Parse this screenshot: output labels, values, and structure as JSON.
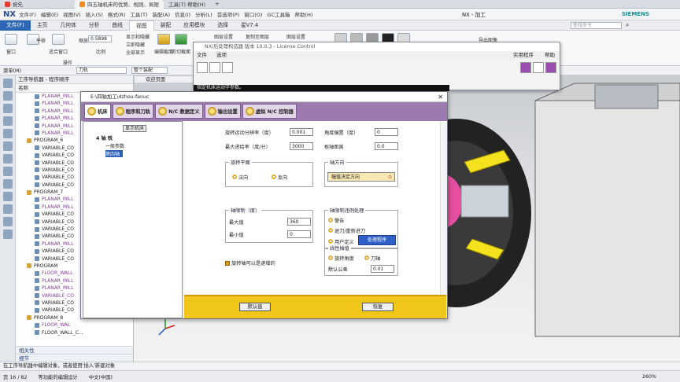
{
  "browser": {
    "tabs": [
      "祝先",
      "四五轴机床的优势、规则、局限",
      "工具(T) 帮助(H)"
    ],
    "new_tab": "+"
  },
  "titlebar": {
    "logo": "NX",
    "menus": [
      "文件(F)",
      "编辑(E)",
      "视图(V)",
      "插入(S)",
      "格式(R)",
      "工具(T)",
      "装配(A)",
      "信息(I)",
      "分析(L)",
      "首选项(P)",
      "窗口(O)",
      "GC工具箱",
      "帮助(H)"
    ],
    "title": "NX - 加工",
    "brand": "SIEMENS"
  },
  "ribbon": {
    "tabs": [
      "文件(F)",
      "主页",
      "几何体",
      "分析",
      "曲线",
      "视图",
      "装配",
      "应用模块",
      "选择",
      "星V7.4"
    ],
    "selected_tab": "视图",
    "search_placeholder": "查找命令",
    "tools_left": [
      "窗口",
      "平移",
      "适合窗口",
      "缩放",
      "0.5898",
      "比例"
    ],
    "group_op": "操作",
    "tools_mid": [
      "显示和隐藏",
      "立即隐藏",
      "全部显示",
      "编辑截面",
      "剪切截面"
    ],
    "tools_right": [
      "图层设置",
      "复制至图层",
      "图层设置",
      "导出图像"
    ]
  },
  "selbar": {
    "menu": "菜单(M)",
    "combo1": "刀轨",
    "combo2": "整个装配"
  },
  "navigator": {
    "title": "工序导航器 - 程序顺序",
    "column": "名称",
    "rows": [
      {
        "indent": 2,
        "text": "PLANAR_MILL",
        "style": "pur"
      },
      {
        "indent": 2,
        "text": "PLANAR_MILL",
        "style": "pur"
      },
      {
        "indent": 2,
        "text": "PLANAR_MILL",
        "style": "pur"
      },
      {
        "indent": 2,
        "text": "PLANAR_MILL",
        "style": "pur"
      },
      {
        "indent": 2,
        "text": "PLANAR_MILL",
        "style": "pur"
      },
      {
        "indent": 2,
        "text": "PLANAR_MILL",
        "style": "pur"
      },
      {
        "indent": 1,
        "text": "PROGRAM_6",
        "style": "bold"
      },
      {
        "indent": 2,
        "text": "VARIABLE_CO",
        "style": ""
      },
      {
        "indent": 2,
        "text": "VARIABLE_CO",
        "style": ""
      },
      {
        "indent": 2,
        "text": "VARIABLE_CO",
        "style": ""
      },
      {
        "indent": 2,
        "text": "VARIABLE_CO",
        "style": ""
      },
      {
        "indent": 2,
        "text": "VARIABLE_CO",
        "style": ""
      },
      {
        "indent": 2,
        "text": "VARIABLE_CO",
        "style": ""
      },
      {
        "indent": 1,
        "text": "PROGRAM_7",
        "style": "bold"
      },
      {
        "indent": 2,
        "text": "PLANAR_MILL",
        "style": "pur"
      },
      {
        "indent": 2,
        "text": "PLANAR_MILL",
        "style": "pur"
      },
      {
        "indent": 2,
        "text": "VARIABLE_CO",
        "style": ""
      },
      {
        "indent": 2,
        "text": "VARIABLE_CO",
        "style": ""
      },
      {
        "indent": 2,
        "text": "VARIABLE_CO",
        "style": ""
      },
      {
        "indent": 2,
        "text": "VARIABLE_CO",
        "style": ""
      },
      {
        "indent": 2,
        "text": "PLANAR_MILL",
        "style": "pur"
      },
      {
        "indent": 2,
        "text": "VARIABLE_CO",
        "style": ""
      },
      {
        "indent": 2,
        "text": "VARIABLE_CO",
        "style": ""
      },
      {
        "indent": 1,
        "text": "PROGRAM",
        "style": "bold"
      },
      {
        "indent": 2,
        "text": "FLOOR_WALL",
        "style": "pur"
      },
      {
        "indent": 2,
        "text": "PLANAR_MILL",
        "style": "pur"
      },
      {
        "indent": 2,
        "text": "PLANAR_MILL",
        "style": "pur"
      },
      {
        "indent": 2,
        "text": "VARIABLE_CO",
        "style": "pur"
      },
      {
        "indent": 2,
        "text": "VARIABLE_CO",
        "style": ""
      },
      {
        "indent": 2,
        "text": "VARIABLE_CO",
        "style": ""
      },
      {
        "indent": 1,
        "text": "PROGRAM_8",
        "style": "bold"
      },
      {
        "indent": 2,
        "text": "FLOOR_WAL",
        "style": "pur"
      },
      {
        "indent": 2,
        "text": "FLOOR_WALL_C...",
        "style": ""
      }
    ],
    "footer1": "相关性",
    "footer2": "细节"
  },
  "graphics": {
    "tab": "欢迎页面"
  },
  "license": {
    "title": "NX/后处理构造器 版本 10.0.3 - License Control",
    "menus": [
      "文件",
      "选项"
    ],
    "menus_right": [
      "实用程序",
      "帮助"
    ],
    "status": "指定机床运动学参数。"
  },
  "post": {
    "title": "E:\\四轴加工\\4zhou-fanuc",
    "tabs": [
      "机床",
      "程序和刀轨",
      "N/C 数据定义",
      "输出设置",
      "虚拟 N/C 控制器"
    ],
    "tree_header": "显示机床",
    "tree": [
      "4 轴 铣",
      "一般参数",
      "第四轴"
    ],
    "fields": {
      "rot_min_res_label": "旋转运动分辨率（度）",
      "rot_min_res": "0.001",
      "angle_offset_label": "角度偏置（度）",
      "angle_offset": "0",
      "max_feed_label": "最大进给率（度/分）",
      "max_feed": "3000",
      "pivot_label": "枢轴距离",
      "pivot": "0.0"
    },
    "plane_group": "旋转平面",
    "rot_dir_group": "轴旋转",
    "rot_dir_options": [
      "法向",
      "反向"
    ],
    "axis_dir_group": "轴方向",
    "axis_dir_button": "幅值决定方向",
    "limit_group": "轴限制（度）",
    "limit_max_label": "最大值",
    "limit_max": "360",
    "limit_min_label": "最小值",
    "limit_min": "0",
    "viol_group": "轴限制违例处理",
    "viol_options": [
      "警告",
      "退刀/重新进刀",
      "用户定义"
    ],
    "viol_button": "处理程序",
    "incremental": "旋转轴可以是递增的",
    "interp_group": "线性插值",
    "interp_options": [
      "旋转角度",
      "刀轴"
    ],
    "tolerance_label": "默认公差",
    "tolerance": "0.01",
    "btn_default": "默认值",
    "btn_restore": "恢复"
  },
  "status": "在工序导航器中编辑对象，或者使用'插入'新建对象",
  "taskbar": {
    "page": "页 16 / 82",
    "doc": "等功能的编辑设计",
    "lang": "中文(中国)",
    "zoom": "260%"
  }
}
